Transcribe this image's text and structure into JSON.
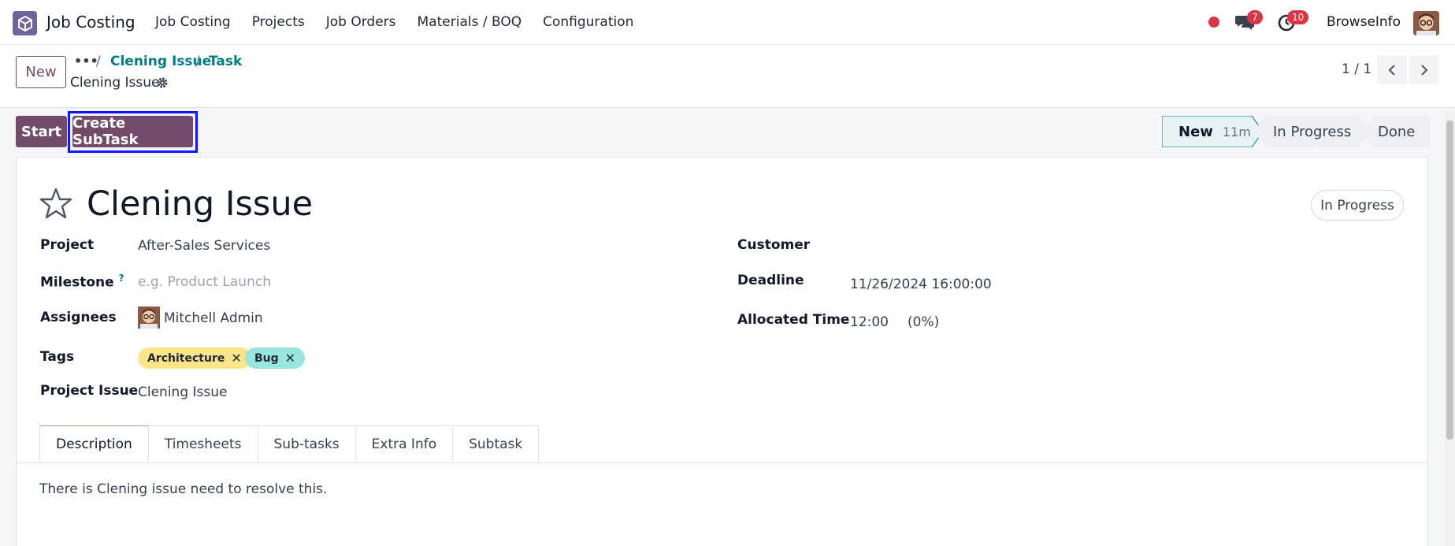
{
  "nav": {
    "app_name": "Job Costing",
    "menu": [
      "Job Costing",
      "Projects",
      "Job Orders",
      "Materials / BOQ",
      "Configuration"
    ],
    "messages_count": "7",
    "activities_count": "10",
    "user_name": "BrowseInfo"
  },
  "control": {
    "new_label": "New",
    "breadcrumb_dots": "•••",
    "breadcrumb": [
      "Clening Issue",
      "Task"
    ],
    "record_title": "Clening Issue",
    "pager": "1 / 1"
  },
  "statusbar": {
    "start_label": "Start",
    "create_subtask_label": "Create SubTask",
    "stages": [
      {
        "label": "New",
        "duration": "11m",
        "active": true
      },
      {
        "label": "In Progress",
        "active": false
      },
      {
        "label": "Done",
        "active": false
      }
    ]
  },
  "task": {
    "title": "Clening Issue",
    "kanban_state": "In Progress",
    "project_label": "Project",
    "project_value": "After-Sales Services",
    "milestone_label": "Milestone",
    "milestone_help": "?",
    "milestone_placeholder": "e.g. Product Launch",
    "assignees_label": "Assignees",
    "assignee_name": "Mitchell Admin",
    "tags_label": "Tags",
    "tags": [
      "Architecture",
      "Bug"
    ],
    "project_issue_label": "Project Issue",
    "project_issue_value": "Clening Issue",
    "customer_label": "Customer",
    "deadline_label": "Deadline",
    "deadline_value": "11/26/2024 16:00:00",
    "allocated_label": "Allocated Time",
    "allocated_value": "12:00",
    "allocated_pct": "(0%)"
  },
  "tabs": [
    "Description",
    "Timesheets",
    "Sub-tasks",
    "Extra Info",
    "Subtask"
  ],
  "description": "There is Clening issue need to resolve this.",
  "colors": {
    "primary": "#714b67",
    "link": "#017e84",
    "tag_architecture": "#fde68a",
    "tag_bug": "#99e6dc",
    "highlight": "#1414ff"
  }
}
